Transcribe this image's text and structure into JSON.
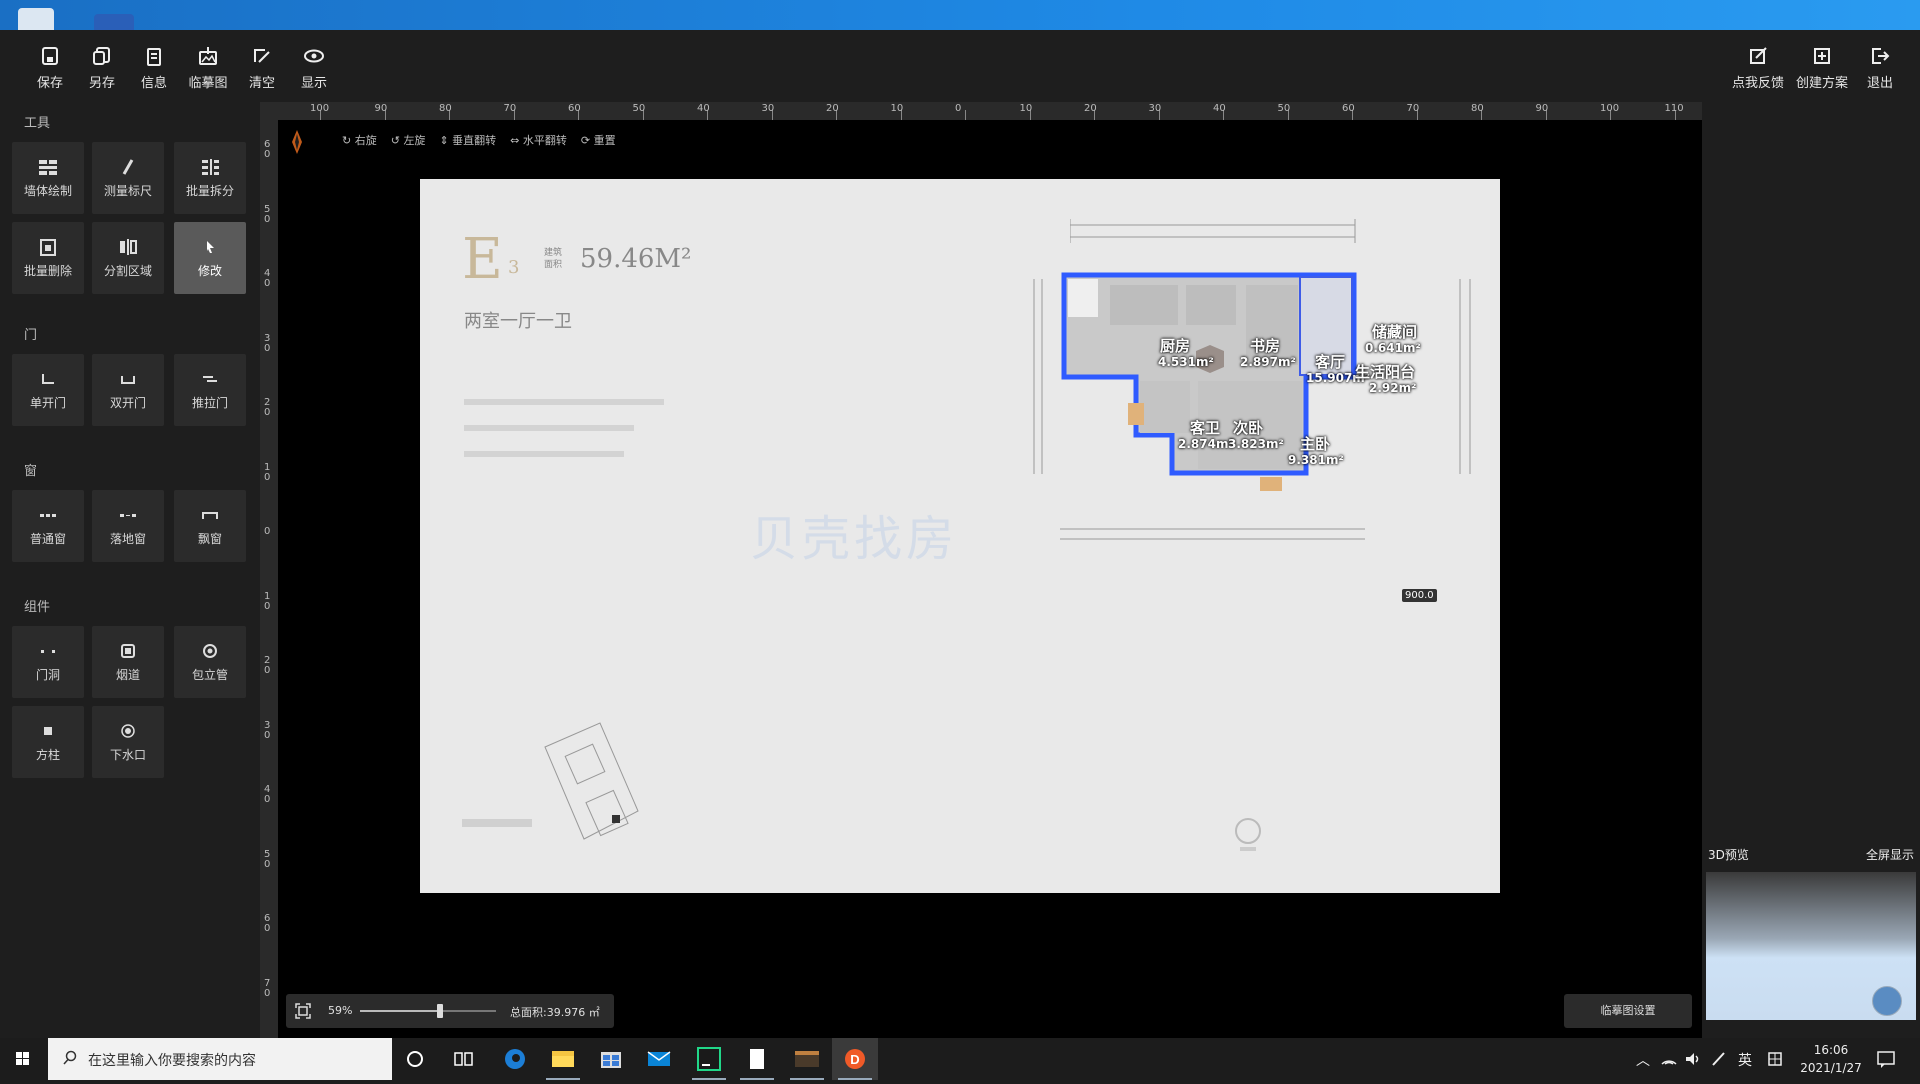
{
  "toolbar": {
    "save": "保存",
    "save_as": "另存",
    "info": "信息",
    "trace_image": "临摹图",
    "clear": "清空",
    "display": "显示",
    "feedback": "点我反馈",
    "create_plan": "创建方案",
    "exit": "退出"
  },
  "sidebar": {
    "tools_title": "工具",
    "tools": [
      "墙体绘制",
      "测量标尺",
      "批量拆分",
      "批量删除",
      "分割区域",
      "修改"
    ],
    "doors_title": "门",
    "doors": [
      "单开门",
      "双开门",
      "推拉门"
    ],
    "windows_title": "窗",
    "windows": [
      "普通窗",
      "落地窗",
      "飘窗"
    ],
    "components_title": "组件",
    "components": [
      "门洞",
      "烟道",
      "包立管",
      "方柱",
      "下水口"
    ]
  },
  "ruler": {
    "top_ticks": [
      "100",
      "90",
      "80",
      "70",
      "60",
      "50",
      "40",
      "30",
      "20",
      "10",
      "0",
      "10",
      "20",
      "30",
      "40",
      "50",
      "60",
      "70",
      "80",
      "90",
      "100",
      "110"
    ],
    "left_ticks": [
      "6\n0",
      "5\n0",
      "4\n0",
      "3\n0",
      "2\n0",
      "1\n0",
      "0",
      "1\n0",
      "2\n0",
      "3\n0",
      "4\n0",
      "5\n0",
      "6\n0",
      "7\n0"
    ]
  },
  "canvas_tools": {
    "rotate_right": "右旋",
    "rotate_left": "左旋",
    "flip_vertical": "垂直翻转",
    "flip_horizontal": "水平翻转",
    "reset": "重置"
  },
  "plan": {
    "code_letter": "E",
    "code_num": "3",
    "area_label_1": "建筑",
    "area_label_2": "面积",
    "area": "59.46M²",
    "layout": "两室一厅一卫",
    "watermark": "贝壳找房",
    "rooms": [
      {
        "name": "厨房",
        "area": "4.531m²"
      },
      {
        "name": "书房",
        "area": "2.897m²"
      },
      {
        "name": "客厅",
        "area": "15.907m²"
      },
      {
        "name": "储藏间",
        "area": "0.641m²"
      },
      {
        "name": "生活阳台",
        "area": "2.92m²"
      },
      {
        "name": "客卫",
        "area": "2.874m²"
      },
      {
        "name": "次卧",
        "area": "3.823m²"
      },
      {
        "name": "主卧",
        "area": "9.381m²"
      }
    ],
    "dimension_tag": "900.0"
  },
  "bottom_bar": {
    "zoom": "59%",
    "zoom_fraction": 0.59,
    "total_area": "总面积:39.976 ㎡"
  },
  "trace_settings": "临摹图设置",
  "preview": {
    "title": "3D预览",
    "fullscreen": "全屏显示"
  },
  "taskbar": {
    "search_placeholder": "在这里输入你要搜索的内容",
    "ime": "英",
    "time": "16:06",
    "date": "2021/1/27"
  },
  "colors": {
    "accent": "#1f8ae6",
    "wall_blue": "#2f5bff",
    "panel": "#1e1e1e"
  }
}
